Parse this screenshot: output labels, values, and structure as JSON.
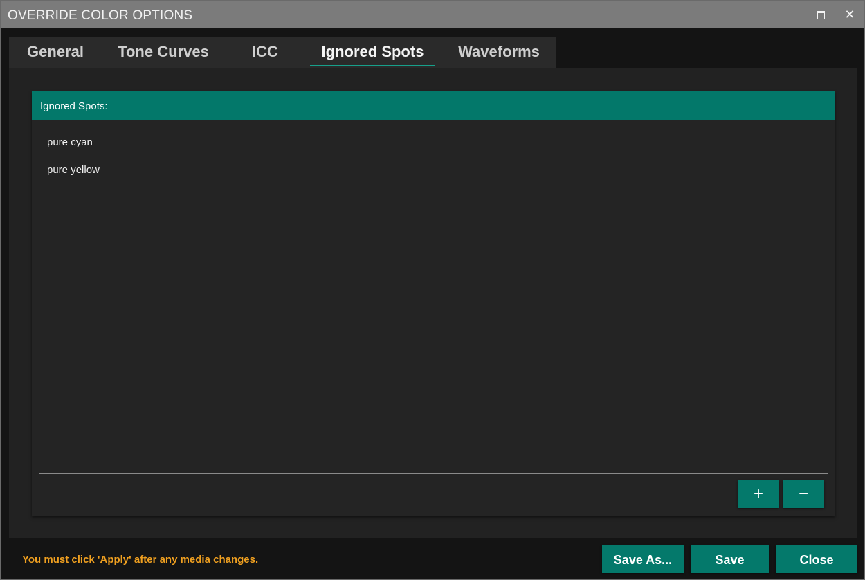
{
  "window": {
    "title": "OVERRIDE COLOR OPTIONS",
    "maximize_icon": "maximize-icon",
    "close_glyph": "✕"
  },
  "tabs": [
    {
      "label": "General",
      "active": false
    },
    {
      "label": "Tone Curves",
      "active": false
    },
    {
      "label": "ICC",
      "active": false
    },
    {
      "label": "Ignored Spots",
      "active": true
    },
    {
      "label": "Waveforms",
      "active": false
    }
  ],
  "ignored_spots": {
    "header": "Ignored Spots:",
    "items": [
      "pure cyan",
      "pure yellow"
    ],
    "add_label": "+",
    "remove_label": "−"
  },
  "footer": {
    "note": "You must click 'Apply' after any media changes.",
    "save_as_label": "Save As...",
    "save_label": "Save",
    "close_label": "Close"
  },
  "colors": {
    "accent": "#04796b",
    "tab_underline": "#17a08b",
    "warning_text": "#f0a020",
    "titlebar": "#7b7b7b",
    "background": "#141414"
  }
}
